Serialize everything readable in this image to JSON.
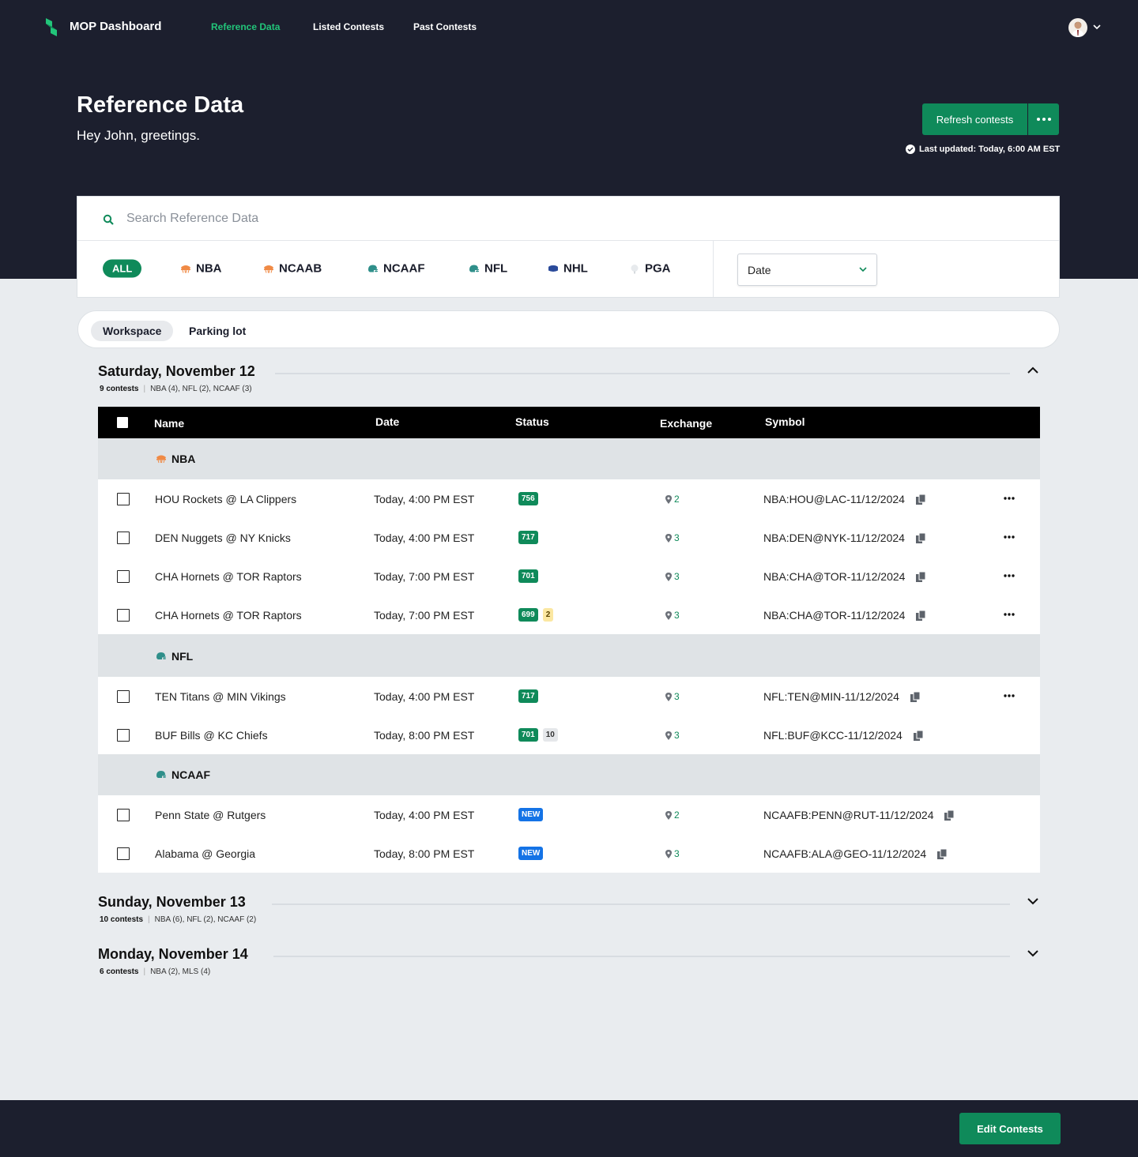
{
  "brand": {
    "name": "MOP Dashboard"
  },
  "nav": {
    "items": [
      {
        "label": "Reference Data",
        "active": true
      },
      {
        "label": "Listed Contests",
        "active": false
      },
      {
        "label": "Past Contests",
        "active": false
      }
    ]
  },
  "header": {
    "title": "Reference Data",
    "greeting": "Hey John, greetings.",
    "refresh_label": "Refresh contests",
    "last_updated": "Last updated: Today, 6:00 AM EST"
  },
  "search": {
    "placeholder": "Search Reference Data",
    "value": ""
  },
  "filters": {
    "sports": [
      {
        "label": "ALL",
        "icon": "all"
      },
      {
        "label": "NBA",
        "icon": "basketball-icon"
      },
      {
        "label": "NCAAB",
        "icon": "basketball-icon"
      },
      {
        "label": "NCAAF",
        "icon": "football-helmet-icon"
      },
      {
        "label": "NFL",
        "icon": "football-helmet-icon"
      },
      {
        "label": "NHL",
        "icon": "hockey-puck-icon"
      },
      {
        "label": "PGA",
        "icon": "golf-ball-icon"
      }
    ],
    "date_select": "Date"
  },
  "tabs": [
    {
      "label": "Workspace",
      "active": true
    },
    {
      "label": "Parking lot",
      "active": false
    }
  ],
  "table_headers": {
    "name": "Name",
    "date": "Date",
    "status": "Status",
    "exchange": "Exchange",
    "symbol": "Symbol"
  },
  "days": [
    {
      "title": "Saturday, November 12",
      "count": "9 contests",
      "summary": "NBA (4), NFL (2), NCAAF (3)",
      "expanded": true,
      "groups": [
        {
          "label": "NBA",
          "rows": [
            {
              "name": "HOU Rockets @ LA Clippers",
              "date": "Today, 4:00 PM EST",
              "status": [
                "756"
              ],
              "status_styles": [
                "green"
              ],
              "exchange": "2",
              "symbol": "NBA:HOU@LAC-11/12/2024"
            },
            {
              "name": "DEN Nuggets @ NY Knicks",
              "date": "Today, 4:00 PM EST",
              "status": [
                "717"
              ],
              "status_styles": [
                "green"
              ],
              "exchange": "3",
              "symbol": "NBA:DEN@NYK-11/12/2024"
            },
            {
              "name": "CHA Hornets @ TOR Raptors",
              "date": "Today, 7:00 PM EST",
              "status": [
                "701"
              ],
              "status_styles": [
                "green"
              ],
              "exchange": "3",
              "symbol": "NBA:CHA@TOR-11/12/2024"
            },
            {
              "name": "CHA Hornets @ TOR Raptors",
              "date": "Today, 7:00 PM EST",
              "status": [
                "699",
                "2"
              ],
              "status_styles": [
                "green",
                "yellow"
              ],
              "exchange": "3",
              "symbol": "NBA:CHA@TOR-11/12/2024"
            }
          ]
        },
        {
          "label": "NFL",
          "rows": [
            {
              "name": "TEN Titans @ MIN Vikings",
              "date": "Today, 4:00 PM EST",
              "status": [
                "717"
              ],
              "status_styles": [
                "green"
              ],
              "exchange": "3",
              "symbol": "NFL:TEN@MIN-11/12/2024"
            },
            {
              "name": "BUF Bills @ KC Chiefs",
              "date": "Today, 8:00 PM EST",
              "status": [
                "701",
                "10"
              ],
              "status_styles": [
                "green",
                "gray"
              ],
              "exchange": "3",
              "symbol": "NFL:BUF@KCC-11/12/2024"
            }
          ]
        },
        {
          "label": "NCAAF",
          "rows": [
            {
              "name": "Penn State @ Rutgers",
              "date": "Today, 4:00 PM EST",
              "status": [
                "NEW"
              ],
              "status_styles": [
                "new"
              ],
              "exchange": "2",
              "symbol": "NCAAFB:PENN@RUT-11/12/2024"
            },
            {
              "name": "Alabama @ Georgia",
              "date": "Today, 8:00 PM EST",
              "status": [
                "NEW"
              ],
              "status_styles": [
                "new"
              ],
              "exchange": "3",
              "symbol": "NCAAFB:ALA@GEO-11/12/2024"
            }
          ]
        }
      ]
    },
    {
      "title": "Sunday, November 13",
      "count": "10 contests",
      "summary": "NBA (6), NFL (2), NCAAF (2)",
      "expanded": false
    },
    {
      "title": "Monday, November 14",
      "count": "6 contests",
      "summary": "NBA (2), MLS (4)",
      "expanded": false
    }
  ],
  "footer": {
    "edit_label": "Edit Contests"
  },
  "colors": {
    "accent": "#0f8a5a",
    "nav_active": "#22c57a",
    "dark_bg": "#1c1f2e",
    "page_bg": "#e9ecef"
  }
}
